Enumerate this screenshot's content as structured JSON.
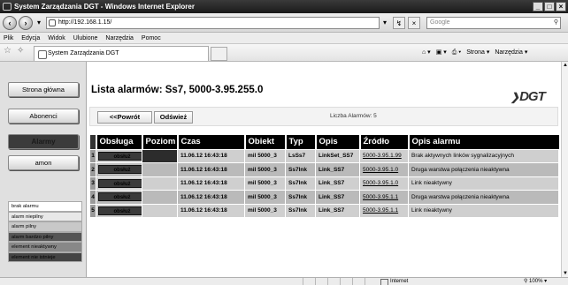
{
  "window": {
    "title": "System Zarządzania DGT - Windows Internet Explorer",
    "controls": [
      "_",
      "□",
      "×"
    ]
  },
  "address": {
    "url": "http://192.168.1.15/",
    "search_placeholder": "Google",
    "dropdown": "▾",
    "refresh": "↯",
    "stop": "×"
  },
  "menu": [
    "Plik",
    "Edycja",
    "Widok",
    "Ulubione",
    "Narzędzia",
    "Pomoc"
  ],
  "favbar": {
    "tab_title": "System Zarządzania DGT",
    "tools": [
      "⌂ ▾",
      "▣ ▾",
      "⎙ ▾",
      "Strona ▾",
      "Narzędzia ▾"
    ]
  },
  "sidebar": {
    "buttons": [
      "Strona główna",
      "Abonenci",
      "Alarmy",
      "amon"
    ],
    "legend": [
      {
        "label": "brak alarmu",
        "color": "#ffffff"
      },
      {
        "label": "alarm niepilny",
        "color": "#e8e8e8"
      },
      {
        "label": "alarm pilny",
        "color": "#c8c8c8"
      },
      {
        "label": "alarm bardzo pilny",
        "color": "#555555"
      },
      {
        "label": "element nieaktywny",
        "color": "#888888"
      },
      {
        "label": "element nie istnieje",
        "color": "#444444"
      }
    ]
  },
  "main": {
    "title": "Lista alarmów:  Ss7, 5000-3.95.255.0",
    "logo": "DGT",
    "back_button": "<<Powrót",
    "refresh_button": "Odśwież",
    "count_text": "Liczba Alarmów: 5"
  },
  "table": {
    "headers": [
      "Obsługa",
      "Poziom",
      "Czas",
      "Obiekt",
      "Typ",
      "Opis",
      "Źródło",
      "Opis alarmu"
    ],
    "action_label": "obsłuż",
    "rows": [
      {
        "n": "1",
        "czas": "11.06.12 16:43:18",
        "obiekt": "mil 5000_3",
        "typ": "LsSs7",
        "opis": "LinkSet_SS7",
        "zrodlo": "5000-3.95.1.99",
        "opis_alarmu": "Brak aktywnych linków sygnalizacyjnych"
      },
      {
        "n": "2",
        "czas": "11.06.12 16:43:18",
        "obiekt": "mil 5000_3",
        "typ": "Ss7lnk",
        "opis": "Link_SS7",
        "zrodlo": "5000-3.95.1.0",
        "opis_alarmu": "Druga warstwa połączenia nieaktywna"
      },
      {
        "n": "3",
        "czas": "11.06.12 16:43:18",
        "obiekt": "mil 5000_3",
        "typ": "Ss7lnk",
        "opis": "Link_SS7",
        "zrodlo": "5000-3.95.1.0",
        "opis_alarmu": "Link nieaktywny"
      },
      {
        "n": "4",
        "czas": "11.06.12 16:43:18",
        "obiekt": "mil 5000_3",
        "typ": "Ss7lnk",
        "opis": "Link_SS7",
        "zrodlo": "5000-3.95.1.1",
        "opis_alarmu": "Druga warstwa połączenia nieaktywna"
      },
      {
        "n": "5",
        "czas": "11.06.12 16:43:18",
        "obiekt": "mil 5000_3",
        "typ": "Ss7lnk",
        "opis": "Link_SS7",
        "zrodlo": "5000-3.95.1.1",
        "opis_alarmu": "Link nieaktywny"
      }
    ]
  },
  "status": {
    "zone": "Internet",
    "zoom": "⚲ 100% ▾"
  }
}
